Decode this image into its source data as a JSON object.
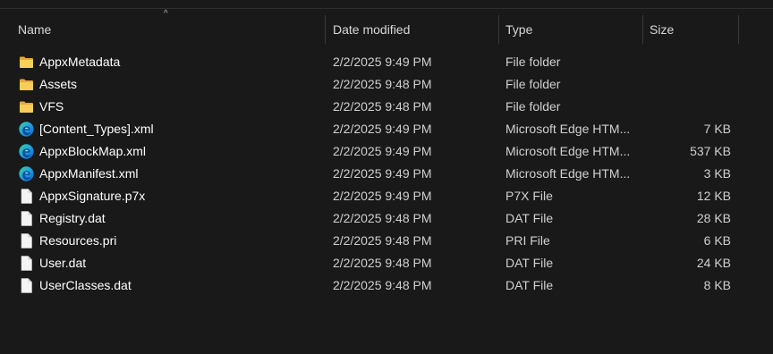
{
  "columns": {
    "name": "Name",
    "date": "Date modified",
    "type": "Type",
    "size": "Size"
  },
  "sort_indicator": "^",
  "files": [
    {
      "name": "AppxMetadata",
      "date": "2/2/2025 9:49 PM",
      "type": "File folder",
      "size": "",
      "icon": "folder-icon"
    },
    {
      "name": "Assets",
      "date": "2/2/2025 9:48 PM",
      "type": "File folder",
      "size": "",
      "icon": "folder-icon"
    },
    {
      "name": "VFS",
      "date": "2/2/2025 9:48 PM",
      "type": "File folder",
      "size": "",
      "icon": "folder-icon"
    },
    {
      "name": "[Content_Types].xml",
      "date": "2/2/2025 9:49 PM",
      "type": "Microsoft Edge HTM...",
      "size": "7 KB",
      "icon": "edge-icon"
    },
    {
      "name": "AppxBlockMap.xml",
      "date": "2/2/2025 9:49 PM",
      "type": "Microsoft Edge HTM...",
      "size": "537 KB",
      "icon": "edge-icon"
    },
    {
      "name": "AppxManifest.xml",
      "date": "2/2/2025 9:49 PM",
      "type": "Microsoft Edge HTM...",
      "size": "3 KB",
      "icon": "edge-icon"
    },
    {
      "name": "AppxSignature.p7x",
      "date": "2/2/2025 9:49 PM",
      "type": "P7X File",
      "size": "12 KB",
      "icon": "file-icon"
    },
    {
      "name": "Registry.dat",
      "date": "2/2/2025 9:48 PM",
      "type": "DAT File",
      "size": "28 KB",
      "icon": "file-icon"
    },
    {
      "name": "Resources.pri",
      "date": "2/2/2025 9:48 PM",
      "type": "PRI File",
      "size": "6 KB",
      "icon": "file-icon"
    },
    {
      "name": "User.dat",
      "date": "2/2/2025 9:48 PM",
      "type": "DAT File",
      "size": "24 KB",
      "icon": "file-icon"
    },
    {
      "name": "UserClasses.dat",
      "date": "2/2/2025 9:48 PM",
      "type": "DAT File",
      "size": "8 KB",
      "icon": "file-icon"
    }
  ]
}
